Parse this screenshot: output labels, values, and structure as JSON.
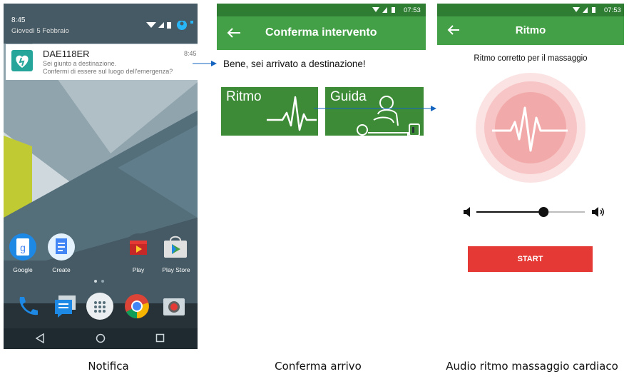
{
  "notifica": {
    "status_time": "8:45",
    "date": "Giovedì 5 Febbraio",
    "notification": {
      "title": "DAE118ER",
      "time": "8:45",
      "line1": "Sei giunto a destinazione.",
      "line2": "Confermi di essere sul luogo dell'emergenza?"
    },
    "apps": [
      "Google",
      "Create",
      "Play",
      "Play Store"
    ],
    "caption": "Notifica"
  },
  "conferma": {
    "status_time": "07:53",
    "title": "Conferma intervento",
    "message": "Bene, sei arrivato a destinazione!",
    "tiles": [
      "Ritmo",
      "Guida"
    ],
    "caption": "Conferma arrivo"
  },
  "ritmo": {
    "status_time": "07:53",
    "title": "Ritmo",
    "subtitle": "Ritmo corretto per il massaggio",
    "volume_level": 0.62,
    "start_label": "START",
    "caption": "Audio ritmo massaggio cardiaco"
  },
  "colors": {
    "green": "#43a047",
    "dark_green": "#2e7d32",
    "red": "#e53935",
    "teal": "#26a69a"
  }
}
